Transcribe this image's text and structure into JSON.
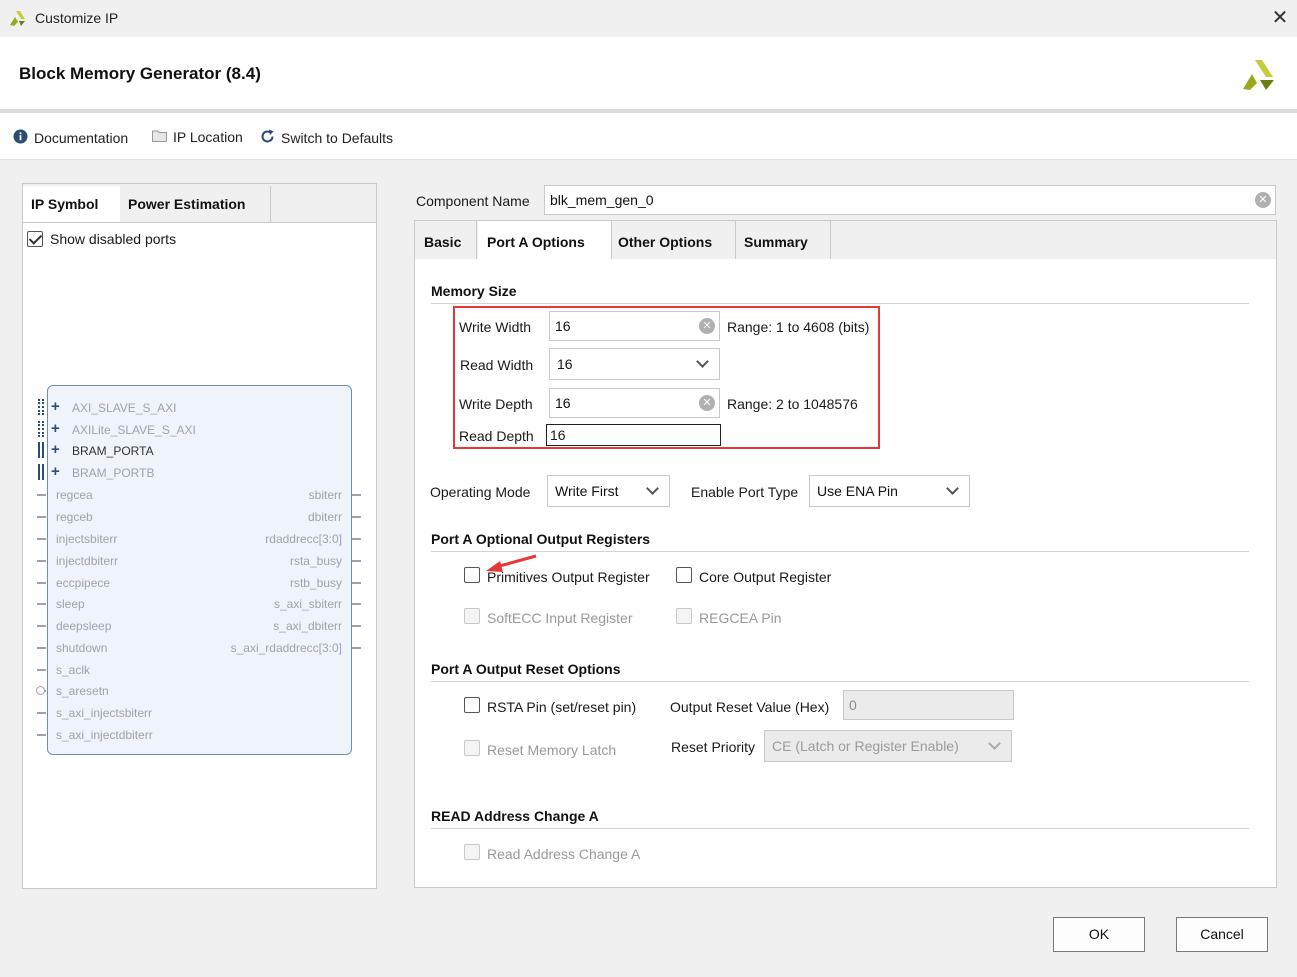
{
  "window": {
    "title": "Customize IP"
  },
  "header": {
    "title": "Block Memory Generator (8.4)"
  },
  "toolbar": {
    "documentation": "Documentation",
    "ip_location": "IP Location",
    "switch_defaults": "Switch to Defaults"
  },
  "left": {
    "tabs": [
      "IP Symbol",
      "Power Estimation"
    ],
    "show_disabled_ports": "Show disabled ports",
    "symbol": {
      "bus_ports": [
        "AXI_SLAVE_S_AXI",
        "AXILite_SLAVE_S_AXI",
        "BRAM_PORTA",
        "BRAM_PORTB"
      ],
      "left_ports": [
        "regcea",
        "regceb",
        "injectsbiterr",
        "injectdbiterr",
        "eccpipece",
        "sleep",
        "deepsleep",
        "shutdown",
        "s_aclk",
        "s_aresetn",
        "s_axi_injectsbiterr",
        "s_axi_injectdbiterr"
      ],
      "right_ports": [
        "sbiterr",
        "dbiterr",
        "rdaddrecc[3:0]",
        "rsta_busy",
        "rstb_busy",
        "s_axi_sbiterr",
        "s_axi_dbiterr",
        "s_axi_rdaddrecc[3:0]"
      ]
    }
  },
  "component": {
    "label": "Component Name",
    "value": "blk_mem_gen_0"
  },
  "tabs": [
    "Basic",
    "Port A Options",
    "Other Options",
    "Summary"
  ],
  "memory_size": {
    "title": "Memory Size",
    "write_width_label": "Write Width",
    "write_width": "16",
    "write_width_range": "Range: 1 to 4608 (bits)",
    "read_width_label": "Read Width",
    "read_width": "16",
    "write_depth_label": "Write Depth",
    "write_depth": "16",
    "write_depth_range": "Range: 2 to 1048576",
    "read_depth_label": "Read Depth",
    "read_depth": "16"
  },
  "operating_mode": {
    "label": "Operating Mode",
    "value": "Write First"
  },
  "enable_port": {
    "label": "Enable Port Type",
    "value": "Use ENA Pin"
  },
  "output_registers": {
    "title": "Port A Optional Output Registers",
    "primitives": "Primitives Output Register",
    "core": "Core Output Register",
    "softecc": "SoftECC Input Register",
    "regcea": "REGCEA Pin"
  },
  "reset_options": {
    "title": "Port A Output Reset Options",
    "rsta_pin": "RSTA Pin (set/reset pin)",
    "output_reset_label": "Output Reset Value (Hex)",
    "output_reset_value": "0",
    "reset_memory_latch": "Reset Memory Latch",
    "reset_priority_label": "Reset Priority",
    "reset_priority_value": "CE (Latch or Register Enable)"
  },
  "read_address": {
    "title": "READ Address Change A",
    "checkbox": "Read Address Change A"
  },
  "buttons": {
    "ok": "OK",
    "cancel": "Cancel"
  },
  "colors": {
    "highlight_box": "#e53935",
    "accent_logo": "#9aaa1f"
  }
}
